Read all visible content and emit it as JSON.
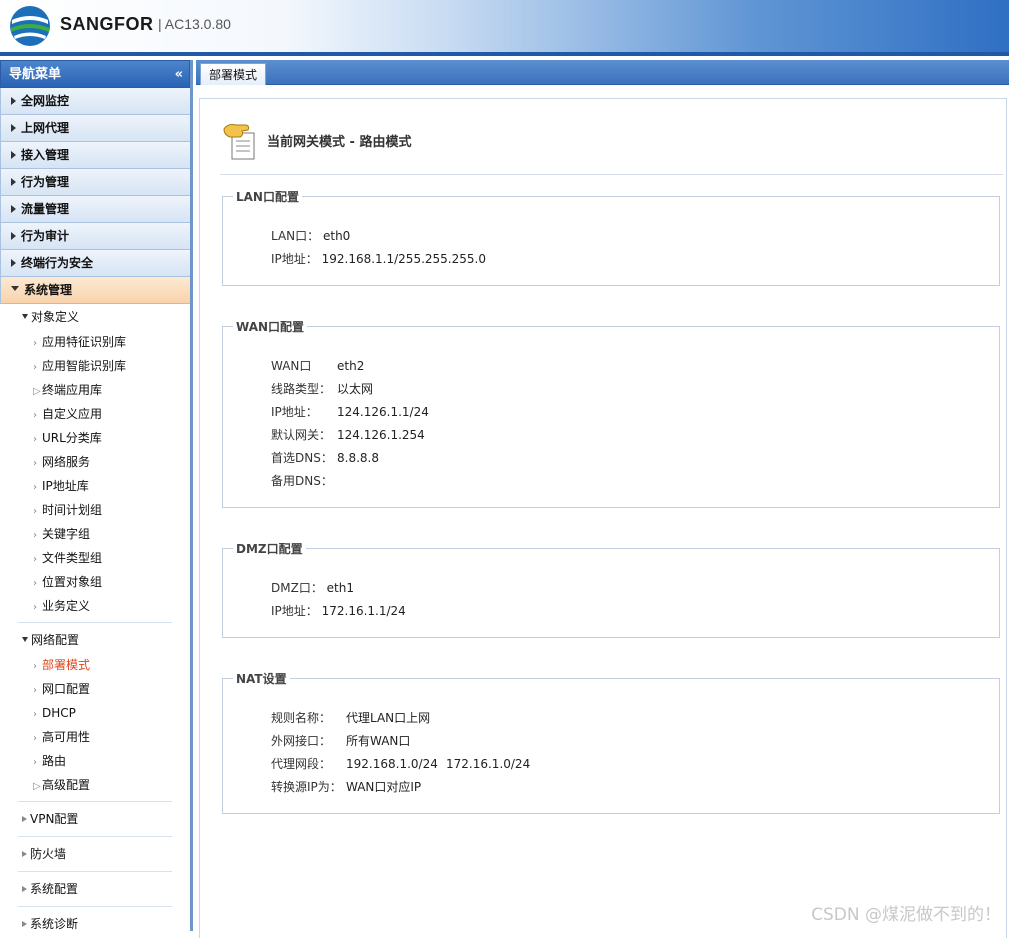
{
  "header": {
    "brand": "SANGFOR",
    "version": "| AC13.0.80"
  },
  "sidebar": {
    "title": "导航菜单",
    "collapse_icon": "«",
    "top_items": [
      "全网监控",
      "上网代理",
      "接入管理",
      "行为管理",
      "流量管理",
      "行为审计",
      "终端行为安全"
    ],
    "open_item": "系统管理",
    "groups": [
      {
        "label": "对象定义",
        "items": [
          "应用特征识别库",
          "应用智能识别库",
          "终端应用库",
          "自定义应用",
          "URL分类库",
          "网络服务",
          "IP地址库",
          "时间计划组",
          "关键字组",
          "文件类型组",
          "位置对象组",
          "业务定义"
        ]
      },
      {
        "label": "网络配置",
        "items": [
          "部署模式",
          "网口配置",
          "DHCP",
          "高可用性",
          "路由",
          "高级配置"
        ],
        "active": "部署模式"
      }
    ],
    "closed_groups": [
      "VPN配置",
      "防火墙",
      "系统配置",
      "系统诊断"
    ]
  },
  "tab": {
    "label": "部署模式"
  },
  "mode": {
    "title": "当前网关模式 - 路由模式"
  },
  "lan": {
    "legend": "LAN口配置",
    "port_label": "LAN口：",
    "port_value": "eth0",
    "ip_label": "IP地址：",
    "ip_value": "192.168.1.1/255.255.255.0"
  },
  "wan": {
    "legend": "WAN口配置",
    "port_label": "WAN口",
    "port_value": "eth2",
    "line_label": "线路类型：",
    "line_value": "以太网",
    "ip_label": "IP地址：",
    "ip_value": "124.126.1.1/24",
    "gw_label": "默认网关：",
    "gw_value": "124.126.1.254",
    "dns1_label": "首选DNS：",
    "dns1_value": "8.8.8.8",
    "dns2_label": "备用DNS：",
    "dns2_value": ""
  },
  "dmz": {
    "legend": "DMZ口配置",
    "port_label": "DMZ口：",
    "port_value": "eth1",
    "ip_label": "IP地址：",
    "ip_value": "172.16.1.1/24"
  },
  "nat": {
    "legend": "NAT设置",
    "rule_label": "规则名称：",
    "rule_value": "代理LAN口上网",
    "ext_label": "外网接口：",
    "ext_value": "所有WAN口",
    "seg_label": "代理网段：",
    "seg_value1": "192.168.1.0/24",
    "seg_value2": "172.16.1.0/24",
    "src_label": "转换源IP为：",
    "src_value": "WAN口对应IP"
  },
  "watermark": "CSDN @煤泥做不到的！"
}
